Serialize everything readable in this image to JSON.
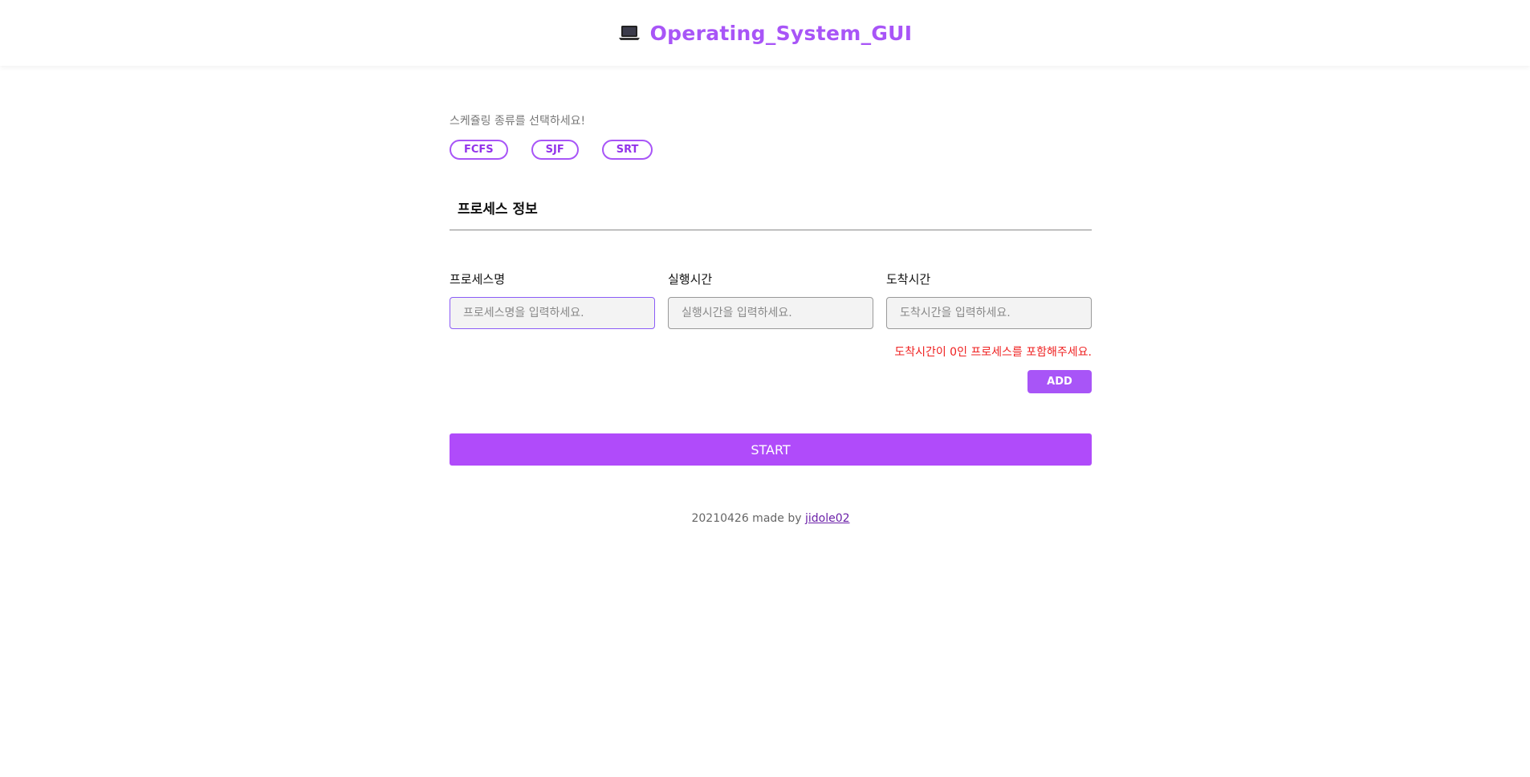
{
  "header": {
    "title": "Operating_System_GUI",
    "icon": "laptop-icon",
    "accent_color": "#a855f7"
  },
  "scheduling": {
    "prompt": "스케쥴링 종류를 선택하세요!",
    "options": [
      "FCFS",
      "SJF",
      "SRT"
    ]
  },
  "process_info": {
    "section_title": "프로세스 정보",
    "fields": [
      {
        "label": "프로세스명",
        "placeholder": "프로세스명을 입력하세요.",
        "value": ""
      },
      {
        "label": "실행시간",
        "placeholder": "실행시간을 입력하세요.",
        "value": ""
      },
      {
        "label": "도착시간",
        "placeholder": "도착시간을 입력하세요.",
        "value": ""
      }
    ],
    "warning": "도착시간이 0인 프로세스를 포함해주세요.",
    "warning_color": "#ef2020",
    "add_label": "ADD"
  },
  "start_label": "START",
  "footer": {
    "text": "20210426 made by",
    "link_text": "jidole02"
  }
}
